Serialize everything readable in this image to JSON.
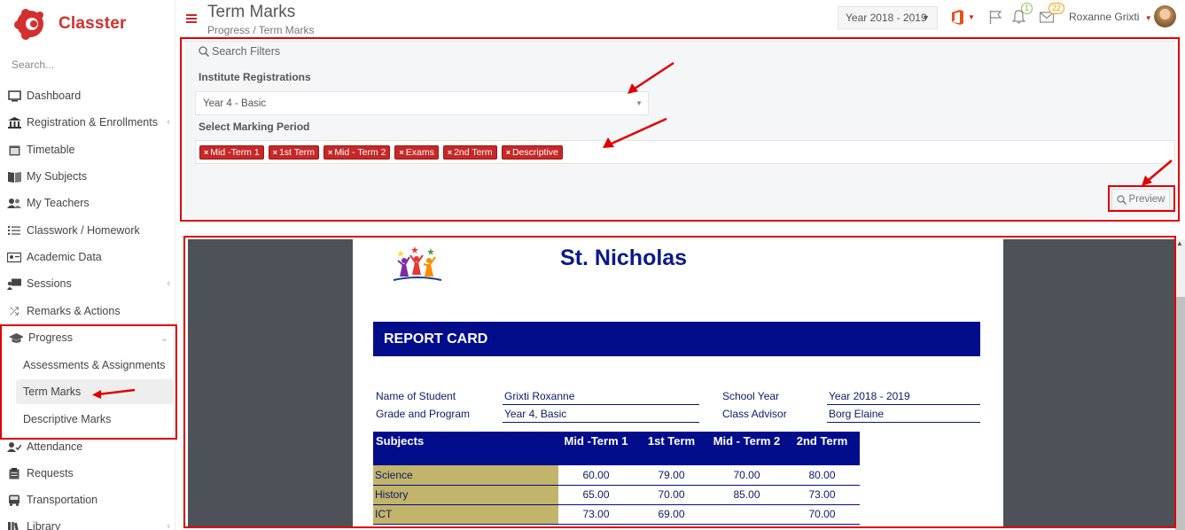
{
  "app": {
    "name": "Classter"
  },
  "sidebar": {
    "search_placeholder": "Search...",
    "items": [
      {
        "label": "Dashboard",
        "icon": "monitor-icon"
      },
      {
        "label": "Registration & Enrollments",
        "icon": "institution-icon"
      },
      {
        "label": "Timetable",
        "icon": "calendar-icon"
      },
      {
        "label": "My Subjects",
        "icon": "book-icon"
      },
      {
        "label": "My Teachers",
        "icon": "users-icon"
      },
      {
        "label": "Classwork / Homework",
        "icon": "list-icon"
      },
      {
        "label": "Academic Data",
        "icon": "id-card-icon"
      },
      {
        "label": "Sessions",
        "icon": "presentation-icon"
      },
      {
        "label": "Remarks & Actions",
        "icon": "shuffle-icon"
      },
      {
        "label": "Progress",
        "icon": "graduation-cap-icon"
      },
      {
        "label": "Attendance",
        "icon": "user-check-icon"
      },
      {
        "label": "Requests",
        "icon": "clipboard-icon"
      },
      {
        "label": "Transportation",
        "icon": "bus-icon"
      },
      {
        "label": "Library",
        "icon": "library-icon"
      }
    ],
    "progress_sub": [
      "Assessments & Assignments",
      "Term Marks",
      "Descriptive Marks"
    ]
  },
  "header": {
    "title": "Term Marks",
    "breadcrumb": "Progress  /  Term Marks",
    "year": "Year 2018 - 2019",
    "notifications_count": "1",
    "messages_count": "22",
    "user_name": "Roxanne Grixti"
  },
  "filters": {
    "legend": "Search Filters",
    "registration_label": "Institute Registrations",
    "registration_value": "Year 4 - Basic",
    "marking_label": "Select Marking Period",
    "marking_tags": [
      "Mid -Term 1",
      "1st Term",
      "Mid - Term 2",
      "Exams",
      "2nd Term",
      "Descriptive"
    ],
    "preview_label": "Preview"
  },
  "report": {
    "school": "St. Nicholas",
    "banner": "REPORT CARD",
    "student_label": "Name of Student",
    "student": "Grixti Roxanne",
    "grade_label": "Grade and Program",
    "grade": "Year 4, Basic",
    "year_label": "School Year",
    "year": "Year 2018 - 2019",
    "advisor_label": "Class Advisor",
    "advisor": "Borg Elaine",
    "columns": [
      "Subjects",
      "Mid -Term 1",
      "1st Term",
      "Mid - Term 2",
      "2nd Term"
    ],
    "rows": [
      {
        "subject": "Science",
        "values": [
          "60.00",
          "79.00",
          "70.00",
          "80.00"
        ]
      },
      {
        "subject": "History",
        "values": [
          "65.00",
          "70.00",
          "85.00",
          "73.00"
        ]
      },
      {
        "subject": "ICT",
        "values": [
          "73.00",
          "69.00",
          "",
          "70.00"
        ]
      }
    ]
  },
  "colors": {
    "brand": "#d32f2f",
    "tag": "#c62828",
    "report_blue": "#020d8c",
    "subject_cell": "#c2b46a"
  }
}
